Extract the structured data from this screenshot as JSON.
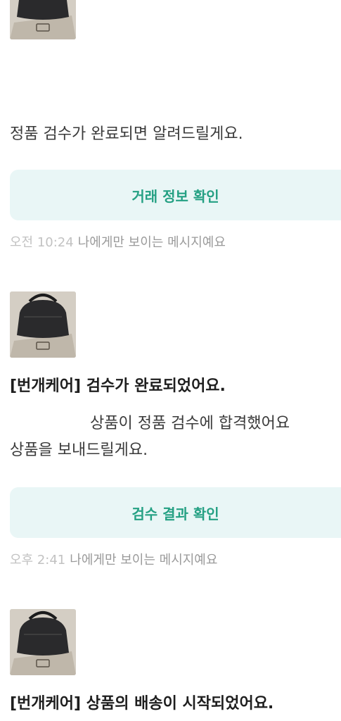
{
  "messages": [
    {
      "image": "product-bag-thumbnail",
      "body_line1": "정품 검수가 완료되면 알려드릴게요.",
      "action_label": "거래 정보 확인",
      "time": "오전 10:24",
      "note": "나에게만 보이는 메시지예요"
    },
    {
      "image": "product-bag-thumbnail",
      "title": "[번개케어] 검수가 완료되었어요.",
      "body_line1": "상품이 정품 검수에 합격했어요",
      "body_line2": "상품을 보내드릴게요.",
      "action_label": "검수 결과 확인",
      "time": "오후 2:41",
      "note": "나에게만 보이는 메시지예요"
    },
    {
      "image": "product-bag-thumbnail",
      "title": "[번개케어] 상품의 배송이 시작되었어요."
    }
  ],
  "colors": {
    "accent": "#24a083",
    "action_bg": "#e9f6f6",
    "meta_text": "#9a9a9a"
  }
}
